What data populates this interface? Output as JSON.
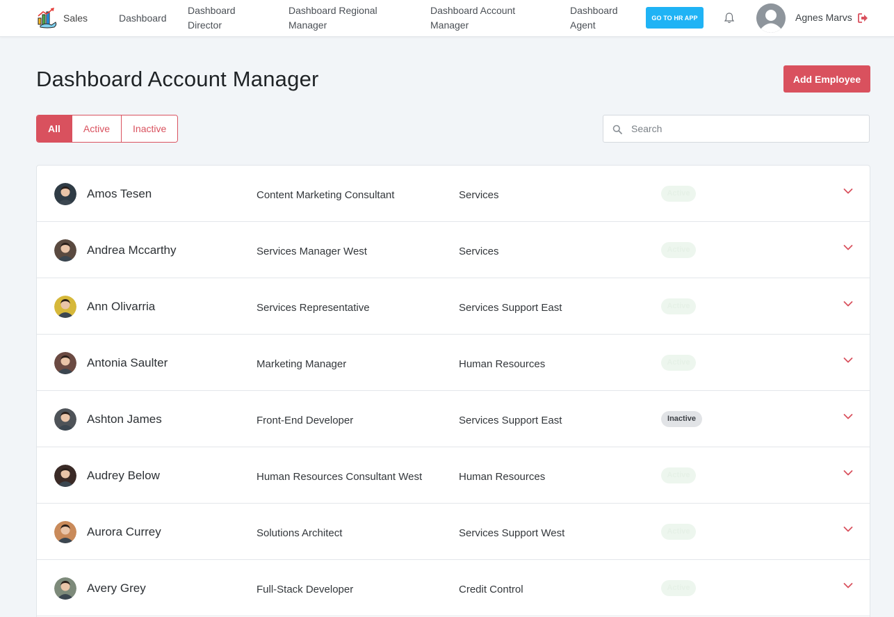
{
  "nav": {
    "brand_label": "Sales",
    "links": [
      {
        "label_line1": "Dashboard",
        "label_line2": ""
      },
      {
        "label_line1": "Dashboard",
        "label_line2": "Director"
      },
      {
        "label_line1": "Dashboard Regional",
        "label_line2": "Manager"
      },
      {
        "label_line1": "Dashboard Account",
        "label_line2": "Manager"
      },
      {
        "label_line1": "Dashboard",
        "label_line2": "Agent"
      }
    ],
    "hr_button": "GO TO HR APP",
    "user_name": "Agnes Marvs"
  },
  "page": {
    "title": "Dashboard Account Manager",
    "add_button": "Add Employee"
  },
  "filters": {
    "all": "All",
    "active": "Active",
    "inactive": "Inactive",
    "selected": "All"
  },
  "search": {
    "placeholder": "Search"
  },
  "colors": {
    "accent": "#d9515e",
    "hr_button": "#1fb3f5",
    "active_badge_bg": "#edf6ee",
    "inactive_badge_bg": "#e1e3e6"
  },
  "employees": [
    {
      "name": "Amos Tesen",
      "title": "Content Marketing Consultant",
      "department": "Services",
      "status": "Active",
      "avatar_color": "#2f3b45"
    },
    {
      "name": "Andrea Mccarthy",
      "title": "Services Manager West",
      "department": "Services",
      "status": "Active",
      "avatar_color": "#5a4a40"
    },
    {
      "name": "Ann Olivarria",
      "title": "Services Representative",
      "department": "Services Support East",
      "status": "Active",
      "avatar_color": "#d6b83a"
    },
    {
      "name": "Antonia Saulter",
      "title": "Marketing Manager",
      "department": "Human Resources",
      "status": "Active",
      "avatar_color": "#6b4a42"
    },
    {
      "name": "Ashton James",
      "title": "Front-End Developer",
      "department": "Services Support East",
      "status": "Inactive",
      "avatar_color": "#4e5358"
    },
    {
      "name": "Audrey Below",
      "title": "Human Resources Consultant West",
      "department": "Human Resources",
      "status": "Active",
      "avatar_color": "#3a2a26"
    },
    {
      "name": "Aurora Currey",
      "title": "Solutions Architect",
      "department": "Services Support West",
      "status": "Active",
      "avatar_color": "#c98a5a"
    },
    {
      "name": "Avery Grey",
      "title": "Full-Stack Developer",
      "department": "Credit Control",
      "status": "Active",
      "avatar_color": "#7d8a7a"
    }
  ]
}
